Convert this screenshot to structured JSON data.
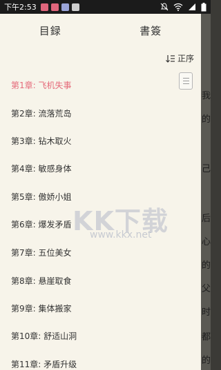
{
  "status_bar": {
    "time": "下午2:53",
    "notification_colors": [
      "#e0667c",
      "#e0667c",
      "#9aa4d8"
    ]
  },
  "drawer": {
    "tabs": [
      {
        "label": "目録"
      },
      {
        "label": "書簽"
      }
    ],
    "sort_label": "正序",
    "chapters": [
      {
        "label": "第1章: 飞机失事",
        "active": true
      },
      {
        "label": "第2章: 流落荒岛"
      },
      {
        "label": "第3章: 钻木取火"
      },
      {
        "label": "第4章: 敏感身体"
      },
      {
        "label": "第5章: 傲娇小姐"
      },
      {
        "label": "第6章: 爆发矛盾"
      },
      {
        "label": "第7章: 五位美女"
      },
      {
        "label": "第8章: 悬崖取食"
      },
      {
        "label": "第9章: 集体搬家"
      },
      {
        "label": "第10章: 舒适山洞"
      },
      {
        "label": "第11章: 矛盾升级"
      }
    ],
    "active_color": "#e56a7a"
  },
  "watermark": {
    "main": "KK下载",
    "url": "www.kkx.net"
  },
  "background_text": [
    "我",
    "的",
    "己",
    "后",
    "心",
    "的",
    "父",
    "时",
    "都",
    "的"
  ]
}
